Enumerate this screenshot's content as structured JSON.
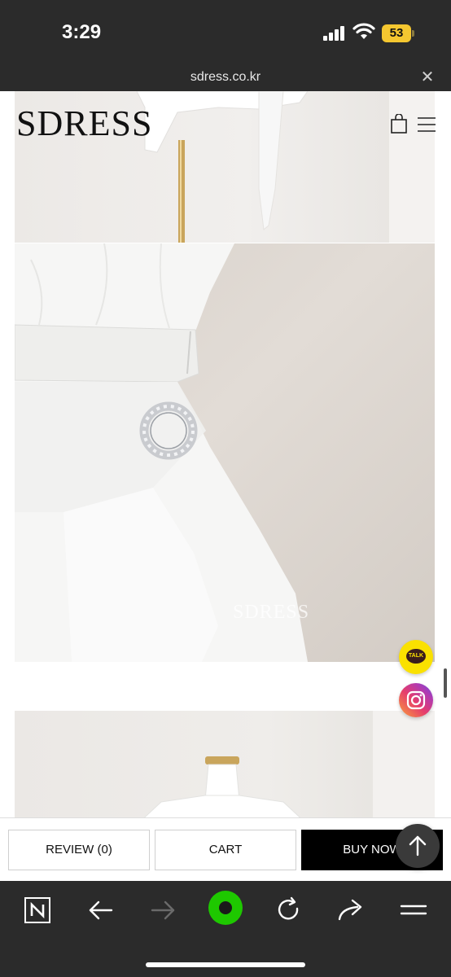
{
  "status_bar": {
    "time": "3:29",
    "battery": "53",
    "icons": [
      "signal-icon",
      "wifi-icon",
      "battery-icon"
    ]
  },
  "url_bar": {
    "url": "sdress.co.kr",
    "close_icon": "close-icon"
  },
  "header": {
    "logo": "SDRESS",
    "icons": [
      "shopping-bag-icon",
      "hamburger-menu-icon"
    ]
  },
  "gallery": {
    "watermark": "SDRESS"
  },
  "floating": {
    "talk_label": "TALK",
    "icons": [
      "kakaotalk-icon",
      "instagram-icon"
    ]
  },
  "actions": {
    "review_label": "REVIEW (0)",
    "cart_label": "CART",
    "buy_label": "BUY NOW",
    "scroll_top_icon": "arrow-up-icon"
  },
  "toolbar": {
    "icons": [
      "naver-home-icon",
      "back-arrow-icon",
      "forward-arrow-icon",
      "green-dot-icon",
      "reload-icon",
      "share-icon",
      "menu-icon"
    ]
  },
  "colors": {
    "chrome": "#2b2b2b",
    "buy_button": "#000000",
    "talk_yellow": "#fae100",
    "battery_yellow": "#f5c730",
    "green_dot": "#1ec800"
  }
}
